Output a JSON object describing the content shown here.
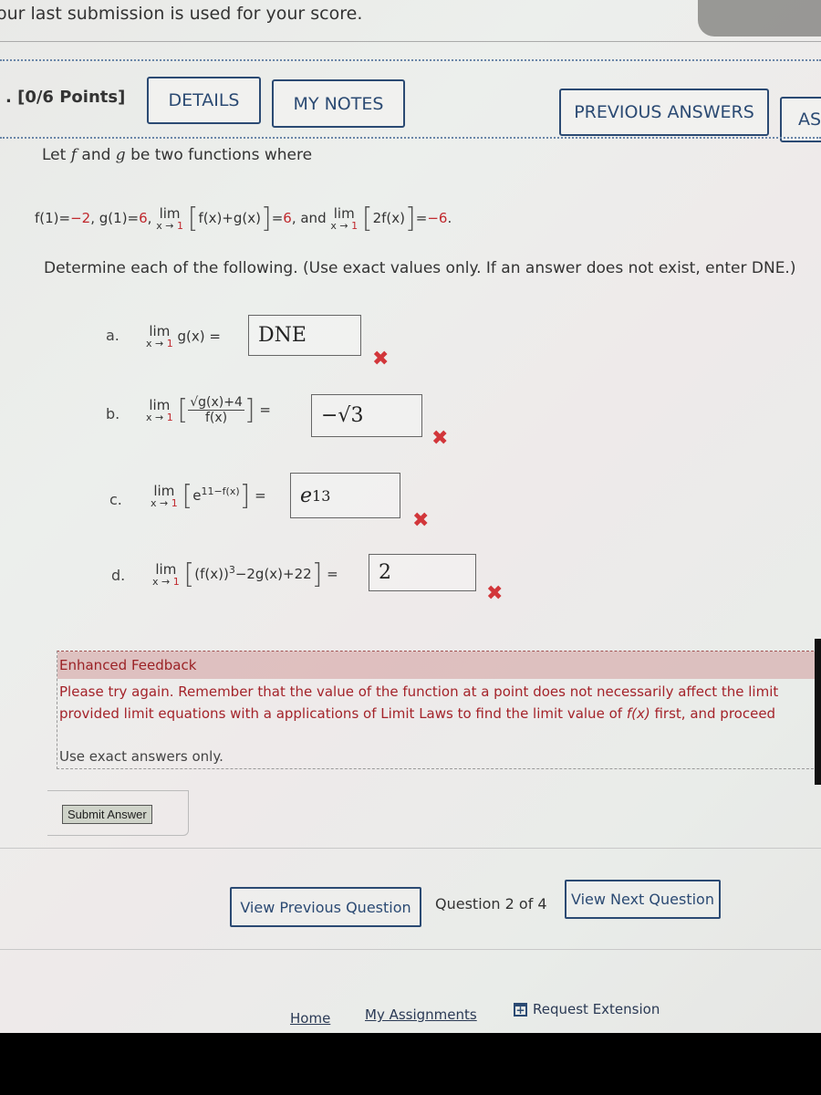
{
  "notice": "our last submission is used for your score.",
  "header": {
    "points": ". [0/6 Points]",
    "buttons": {
      "details": "DETAILS",
      "my_notes": "MY NOTES",
      "previous_answers": "PREVIOUS ANSWERS",
      "ask": "AS"
    }
  },
  "question": {
    "intro_prefix": "Let",
    "f": "f",
    "and": "and",
    "g": "g",
    "intro_suffix": "be two functions where",
    "given": {
      "f1_label": "f(1)=",
      "f1_value": "−2",
      "g1_label": ", g(1)=",
      "g1_value": "6",
      "lim_word": "lim",
      "lim_sub_x": "x → ",
      "lim_sub_val": "1",
      "expr1": "f(x)+g(x)",
      "eq1": "=",
      "val1": "6",
      "connector": ", and",
      "expr2": "2f(x)",
      "eq2": "=",
      "val2": "−6",
      "end": "."
    },
    "instructions": "Determine each of the following. (Use exact values only. If an answer does not exist, enter DNE.)"
  },
  "parts": [
    {
      "label": "a.",
      "expression": "g(x)",
      "answer": "DNE",
      "status": "incorrect"
    },
    {
      "label": "b.",
      "numerator": "√g(x)+4",
      "denominator": "f(x)",
      "answer": "−√3",
      "status": "incorrect"
    },
    {
      "label": "c.",
      "expression": "e",
      "exponent": "11−f(x)",
      "answer_base": "e",
      "answer_exp": "13",
      "status": "incorrect"
    },
    {
      "label": "d.",
      "expression_pre": "(f(x))",
      "power": "3",
      "expression_post": "−2g(x)+22",
      "answer": "2",
      "status": "incorrect"
    }
  ],
  "incorrect_mark": "✖",
  "feedback": {
    "title": "Enhanced Feedback",
    "line1": "Please try again. Remember that the value of the function at a point does not necessarily affect the limit",
    "line2_pre": "provided limit equations with a applications of Limit Laws to find the limit value of",
    "line2_fx": "f(x)",
    "line2_post": "first, and proceed",
    "exact": "Use exact answers only."
  },
  "submit_label": "Submit Answer",
  "navigation": {
    "previous": "View Previous Question",
    "counter": "Question 2 of 4",
    "next": "View Next Question"
  },
  "footer": {
    "home": "Home",
    "assignments": "My Assignments",
    "extension": "Request Extension",
    "extension_icon": "+"
  },
  "colors": {
    "accent": "#2b4a73",
    "error": "#d2363a",
    "given_value_red": "#c0282d"
  }
}
